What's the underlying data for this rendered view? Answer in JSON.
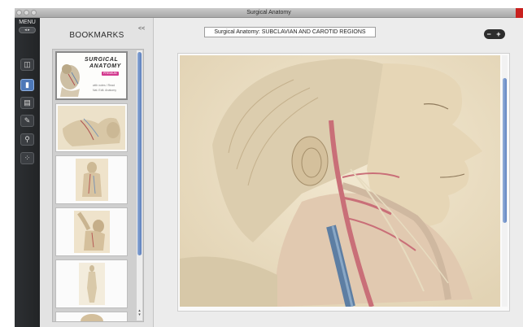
{
  "window": {
    "title": "Surgical Anatomy",
    "accent_color": "#c8201e"
  },
  "toolbar": {
    "menu_label": "MENU",
    "nav_arrows": "◂ ▸",
    "tools": [
      {
        "icon": "page-layout-icon",
        "glyph": "◫"
      },
      {
        "icon": "bookmark-icon",
        "glyph": "▮",
        "active": true
      },
      {
        "icon": "document-icon",
        "glyph": "▤"
      },
      {
        "icon": "pencil-icon",
        "glyph": "✎"
      },
      {
        "icon": "search-icon",
        "glyph": "⚲"
      },
      {
        "icon": "grid-icon",
        "glyph": "⁘"
      }
    ]
  },
  "bookmarks": {
    "title": "BOOKMARKS",
    "collapse_label": "<<",
    "cover": {
      "title_line1": "SURGICAL",
      "title_line2": "ANATOMY",
      "badge": "PREMIUM",
      "caption_line1": "with notes / Read",
      "caption_line2": "Nat. Edit. Anatomy"
    }
  },
  "main": {
    "document_title": "Surgical Anatomy: SUBCLAVIAN AND CAROTID REGIONS",
    "zoom_label": "− +"
  }
}
